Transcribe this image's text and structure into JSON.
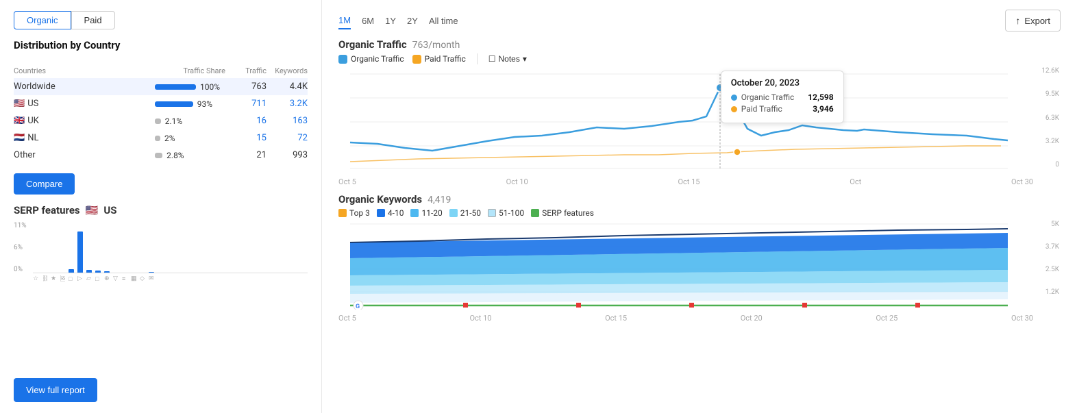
{
  "left": {
    "tabs": [
      {
        "label": "Organic",
        "active": true
      },
      {
        "label": "Paid",
        "active": false
      }
    ],
    "distribution_title": "Distribution by Country",
    "table": {
      "headers": [
        "Countries",
        "Traffic Share",
        "Traffic",
        "Keywords"
      ],
      "rows": [
        {
          "name": "Worldwide",
          "flag": "",
          "bar_pct": 100,
          "bar_wide": true,
          "share": "100%",
          "traffic": "763",
          "keywords": "4.4K",
          "highlight": true,
          "traffic_blue": false,
          "kw_blue": false
        },
        {
          "name": "US",
          "flag": "🇺🇸",
          "bar_pct": 93,
          "bar_wide": true,
          "share": "93%",
          "traffic": "711",
          "keywords": "3.2K",
          "highlight": false,
          "traffic_blue": true,
          "kw_blue": true
        },
        {
          "name": "UK",
          "flag": "🇬🇧",
          "bar_pct": 22,
          "bar_wide": false,
          "share": "2.1%",
          "traffic": "16",
          "keywords": "163",
          "highlight": false,
          "traffic_blue": true,
          "kw_blue": true
        },
        {
          "name": "NL",
          "flag": "🇳🇱",
          "bar_pct": 20,
          "bar_wide": false,
          "share": "2%",
          "traffic": "15",
          "keywords": "72",
          "highlight": false,
          "traffic_blue": true,
          "kw_blue": true
        },
        {
          "name": "Other",
          "flag": "",
          "bar_pct": 28,
          "bar_wide": false,
          "share": "2.8%",
          "traffic": "21",
          "keywords": "993",
          "highlight": false,
          "traffic_blue": false,
          "kw_blue": false
        }
      ]
    },
    "compare_btn": "Compare",
    "serp": {
      "title": "SERP features",
      "region": "US",
      "y_labels": [
        "11%",
        "6%",
        "0%"
      ],
      "bars": [
        0,
        0,
        0,
        0,
        0,
        100,
        0,
        0,
        0,
        0,
        0,
        0,
        0,
        0,
        0,
        0
      ],
      "bar_heights": [
        0,
        0,
        0,
        0,
        5,
        60,
        4,
        3,
        0,
        0,
        0,
        0,
        0,
        0,
        0,
        0
      ]
    },
    "view_report": "View full report"
  },
  "right": {
    "time_filters": [
      "1M",
      "6M",
      "1Y",
      "2Y",
      "All time"
    ],
    "active_filter": "1M",
    "export_btn": "Export",
    "traffic_chart": {
      "title": "Organic Traffic",
      "value": "763/month",
      "legend": [
        {
          "label": "Organic Traffic",
          "color": "#3b9ede",
          "checked": true
        },
        {
          "label": "Paid Traffic",
          "color": "#f5a623",
          "checked": true
        }
      ],
      "notes_label": "Notes",
      "tooltip": {
        "date": "October 20, 2023",
        "rows": [
          {
            "label": "Organic Traffic",
            "color": "#3b9ede",
            "value": "12,598"
          },
          {
            "label": "Paid Traffic",
            "color": "#f5a623",
            "value": "3,946"
          }
        ]
      },
      "x_labels": [
        "Oct 5",
        "Oct 10",
        "Oct 15",
        "Oct",
        "Oct 30"
      ],
      "y_labels": [
        "12.6K",
        "9.5K",
        "6.3K",
        "3.2K",
        "0"
      ]
    },
    "keywords_chart": {
      "title": "Organic Keywords",
      "value": "4,419",
      "legend": [
        {
          "label": "Top 3",
          "color": "#f5a623",
          "checked": true
        },
        {
          "label": "4-10",
          "color": "#1a73e8",
          "checked": true
        },
        {
          "label": "11-20",
          "color": "#4db8f0",
          "checked": true
        },
        {
          "label": "21-50",
          "color": "#7dd4f5",
          "checked": true
        },
        {
          "label": "51-100",
          "color": "#b3e5fa",
          "checked": true
        },
        {
          "label": "SERP features",
          "color": "#4caf50",
          "checked": true
        }
      ],
      "x_labels": [
        "Oct 5",
        "Oct 10",
        "Oct 15",
        "Oct 20",
        "Oct 25",
        "Oct 30"
      ],
      "y_labels": [
        "5K",
        "3.7K",
        "2.5K",
        "1.2K"
      ]
    }
  }
}
